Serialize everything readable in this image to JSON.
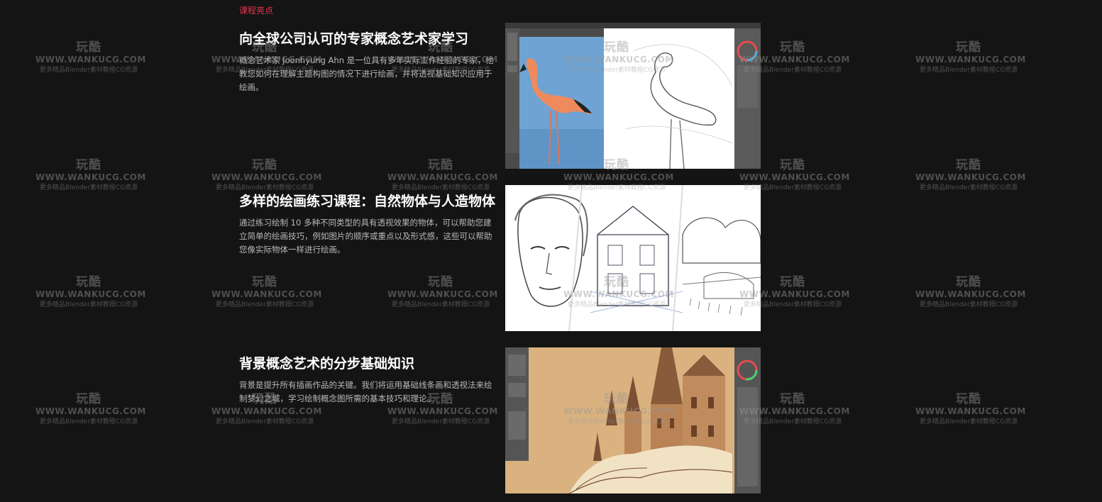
{
  "section": {
    "label": "课程亮点"
  },
  "features": [
    {
      "title": "向全球公司认可的专家概念艺术家学习",
      "desc": "概念艺术家 Joonhyung Ahn 是一位具有多年实际工作经验的专家，他教您如何在理解主题构图的情况下进行绘画，并将透视基础知识应用于绘画。",
      "image": "flamingo-painting-screenshot"
    },
    {
      "title": "多样的绘画练习课程：自然物体与人造物体",
      "desc": "通过练习绘制 10 多种不同类型的具有透视效果的物体，可以帮助您建立简单的绘画技巧，例如图片的顺序或重点以及形式感，这些可以帮助您像实际物体一样进行绘画。",
      "image": "pencil-sketches-collage"
    },
    {
      "title": "背景概念艺术的分步基础知识",
      "desc": "背景是提升所有插画作品的关键。我们将运用基础线条画和透视法来绘制梦幻之城，学习绘制概念图所需的基本技巧和理论。",
      "image": "castle-illustration-screenshot"
    }
  ],
  "watermark": {
    "logo": "玩酷",
    "url": "WWW.WANKUCG.COM",
    "sub": "更多精品Blender素材教程CG资源"
  }
}
